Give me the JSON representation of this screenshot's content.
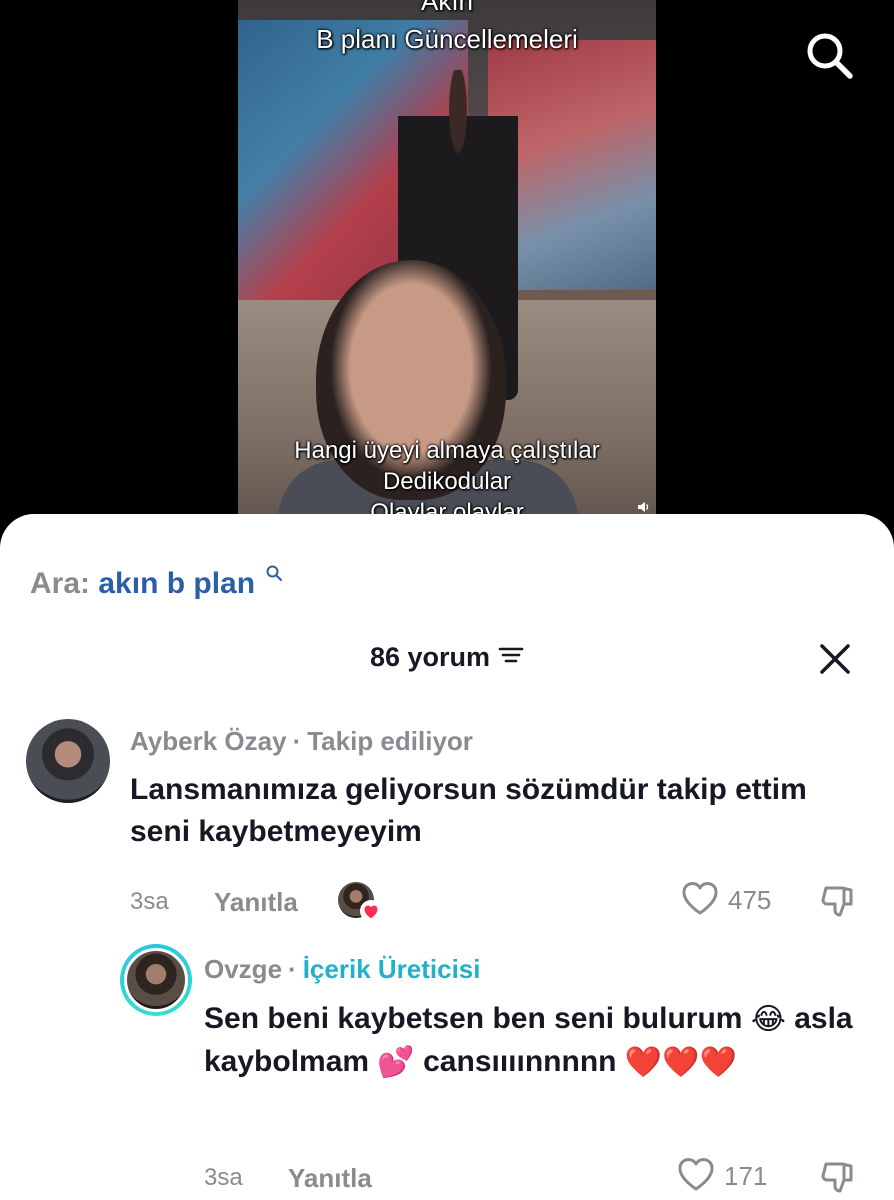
{
  "video": {
    "top_caption_cut": "Akın",
    "top_caption": "B planı Güncellemeleri",
    "bottom_captions": [
      "Hangi üyeyi almaya çalıştılar",
      "Dedikodular",
      "Olaylar olaylar"
    ]
  },
  "icons": {
    "search": "search-icon",
    "volume": "volume-icon",
    "sort": "sort-icon",
    "close": "close-icon",
    "heart": "heart-icon",
    "dislike": "dislike-icon"
  },
  "search_suggestion": {
    "label": "Ara:",
    "query": "akın b plan"
  },
  "comments_header": {
    "count_label": "86 yorum"
  },
  "comments": [
    {
      "author": "Ayberk Özay",
      "badge": "Takip ediliyor",
      "text": "Lansmanımıza geliyorsun sözümdür takip ettim seni kaybetmeyeyim",
      "time": "3sa",
      "reply_label": "Yanıtla",
      "likes": "475",
      "liked_by_creator": true
    },
    {
      "author": "Ovzge",
      "badge": "İçerik Üreticisi",
      "text_parts": [
        "Sen beni kaybetsen ben seni bulurum",
        "asla kaybolmam",
        "cansıııınnnnn"
      ],
      "emojis": [
        "😂",
        "💕",
        "❤️❤️❤️"
      ],
      "time": "3sa",
      "reply_label": "Yanıtla",
      "likes": "171"
    }
  ],
  "colors": {
    "creator_badge": "#21b1c9",
    "search_query": "#2a5fa8",
    "muted": "#8a8b91",
    "text": "#161823",
    "heart_red": "#fe2c55"
  }
}
